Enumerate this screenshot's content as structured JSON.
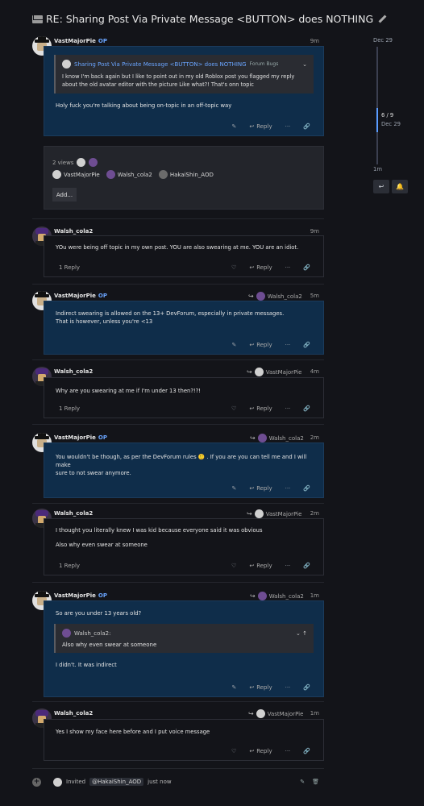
{
  "topic": {
    "title": "RE: Sharing Post Via Private Message <BUTTON> does NOTHING"
  },
  "sidebar": {
    "start_date": "Dec 29",
    "progress": "6 / 9",
    "progress_date": "Dec 29",
    "end_date": "1m",
    "reply_icon": "reply-arrow-icon",
    "bell_icon": "bell-icon"
  },
  "labels": {
    "reply": "Reply",
    "op": "OP"
  },
  "posts": [
    {
      "author": "VastMajorPie",
      "time": "9m",
      "quote": {
        "title": "Sharing Post Via Private Message <BUTTON> does NOTHING",
        "category": "Forum Bugs",
        "text": "I know I'm back again but I like to point out in my old Roblox post you flagged my reply about the old avatar editor with the picture Like what?! That's onn topic"
      },
      "text": "Holy fuck you're talking about being on-topic in an off-topic way"
    },
    {
      "author": "Walsh_cola2",
      "time": "9m",
      "replies": "1 Reply",
      "text": "YOu were being off topic in my own post. YOU are also swearing at me. YOU are an idiot."
    },
    {
      "author": "VastMajorPie",
      "time": "5m",
      "reply_to": "Walsh_cola2",
      "text1": "Indirect swearing is allowed on the 13+ DevForum, especially in private messages.",
      "text2": "That is however, unless you're <13"
    },
    {
      "author": "Walsh_cola2",
      "time": "4m",
      "reply_to": "VastMajorPie",
      "replies": "1 Reply",
      "text": "Why are you swearing at me if I'm under 13 then?!?!"
    },
    {
      "author": "VastMajorPie",
      "time": "2m",
      "reply_to": "Walsh_cola2",
      "text1": "You wouldn't be though, as per the DevForum rules 🙂 . If you are you can tell me and I will make",
      "text2": "sure to not swear anymore."
    },
    {
      "author": "Walsh_cola2",
      "time": "2m",
      "reply_to": "VastMajorPie",
      "replies": "1 Reply",
      "text1": "I thought you literally knew I was kid because everyone said it was obvious",
      "text2": "Also why even swear at someone"
    },
    {
      "author": "VastMajorPie",
      "time": "1m",
      "reply_to": "Walsh_cola2",
      "text": "So are you under 13 years old?",
      "quote_author": "Walsh_cola2:",
      "quote_text": "Also why even swear at someone",
      "text_after": "I didn't. It was indirect"
    },
    {
      "author": "Walsh_cola2",
      "time": "1m",
      "reply_to": "VastMajorPie",
      "text": "Yes I show my face here before and I put voice message"
    }
  ],
  "meta": {
    "views": "2 views",
    "participants": [
      "VastMajorPie",
      "Walsh_cola2",
      "HakaiShin_AOD"
    ],
    "add_label": "Add..."
  },
  "footer": {
    "invited": "Invited",
    "mention": "@HakaiShin_AOD",
    "when": "just now"
  }
}
